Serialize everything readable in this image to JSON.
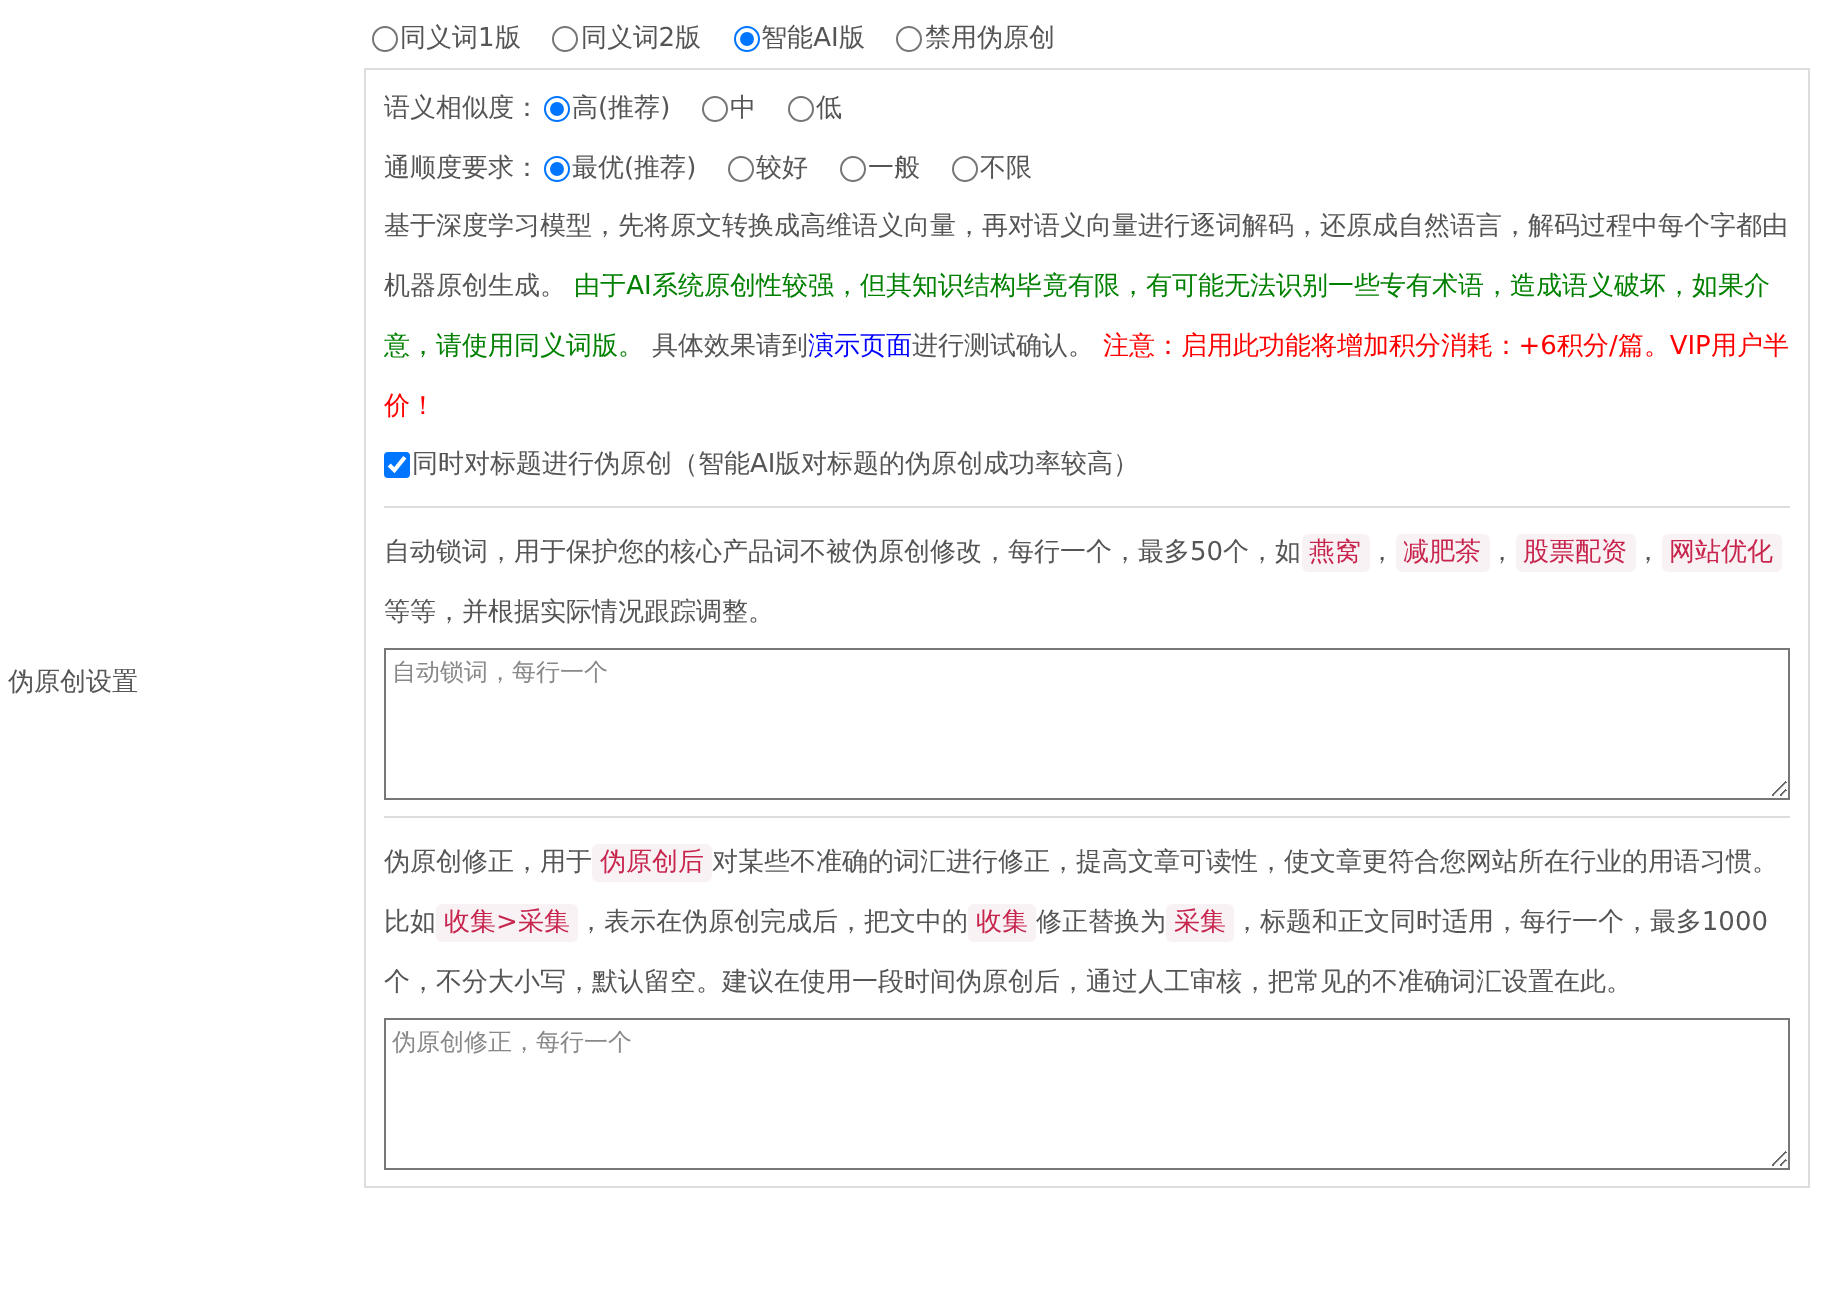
{
  "settings_label": "伪原创设置",
  "version_options": [
    {
      "label": "同义词1版",
      "selected": false
    },
    {
      "label": "同义词2版",
      "selected": false
    },
    {
      "label": "智能AI版",
      "selected": true
    },
    {
      "label": "禁用伪原创",
      "selected": false
    }
  ],
  "similarity": {
    "label": "语义相似度：",
    "options": [
      {
        "label": "高(推荐)",
        "selected": true
      },
      {
        "label": "中",
        "selected": false
      },
      {
        "label": "低",
        "selected": false
      }
    ]
  },
  "fluency": {
    "label": "通顺度要求：",
    "options": [
      {
        "label": "最优(推荐)",
        "selected": true
      },
      {
        "label": "较好",
        "selected": false
      },
      {
        "label": "一般",
        "selected": false
      },
      {
        "label": "不限",
        "selected": false
      }
    ]
  },
  "ai_description": [
    {
      "kind": "plain",
      "text": "基于深度学习模型，先将原文转换成高维语义向量，再对语义向量进行逐词解码，还原成自然语言，解码过程中每个字都由机器原创生成。 "
    },
    {
      "kind": "green",
      "text": "由于AI系统原创性较强，但其知识结构毕竟有限，有可能无法识别一些专有术语，造成语义破坏，如果介意，请使用同义词版。"
    },
    {
      "kind": "plain",
      "text": " 具体效果请到"
    },
    {
      "kind": "link",
      "text": "演示页面"
    },
    {
      "kind": "plain",
      "text": "进行测试确认。 "
    },
    {
      "kind": "red",
      "text": "注意：启用此功能将增加积分消耗：+6积分/篇。VIP用户半价！"
    }
  ],
  "title_option": {
    "label": "同时对标题进行伪原创（智能AI版对标题的伪原创成功率较高）",
    "checked": true
  },
  "lock_words": {
    "description": [
      {
        "kind": "plain",
        "text": "自动锁词，用于保护您的核心产品词不被伪原创修改，每行一个，最多50个，如"
      },
      {
        "kind": "code",
        "text": "燕窝"
      },
      {
        "kind": "plain",
        "text": "，"
      },
      {
        "kind": "code",
        "text": "减肥茶"
      },
      {
        "kind": "plain",
        "text": "，"
      },
      {
        "kind": "code",
        "text": "股票配资"
      },
      {
        "kind": "plain",
        "text": "，"
      },
      {
        "kind": "code",
        "text": "网站优化"
      },
      {
        "kind": "plain",
        "text": " 等等，并根据实际情况跟踪调整。"
      }
    ],
    "placeholder": "自动锁词，每行一个"
  },
  "corrections": {
    "description": [
      {
        "kind": "plain",
        "text": "伪原创修正，用于"
      },
      {
        "kind": "code",
        "text": "伪原创后"
      },
      {
        "kind": "plain",
        "text": "对某些不准确的词汇进行修正，提高文章可读性，使文章更符合您网站所在行业的用语习惯。比如"
      },
      {
        "kind": "code",
        "text": "收集>采集"
      },
      {
        "kind": "plain",
        "text": "，表示在伪原创完成后，把文中的"
      },
      {
        "kind": "code",
        "text": "收集"
      },
      {
        "kind": "plain",
        "text": "修正替换为"
      },
      {
        "kind": "code",
        "text": "采集"
      },
      {
        "kind": "plain",
        "text": "，标题和正文同时适用，每行一个，最多1000个，不分大小写，默认留空。建议在使用一段时间伪原创后，通过人工审核，把常见的不准确词汇设置在此。"
      }
    ],
    "placeholder": "伪原创修正，每行一个"
  }
}
